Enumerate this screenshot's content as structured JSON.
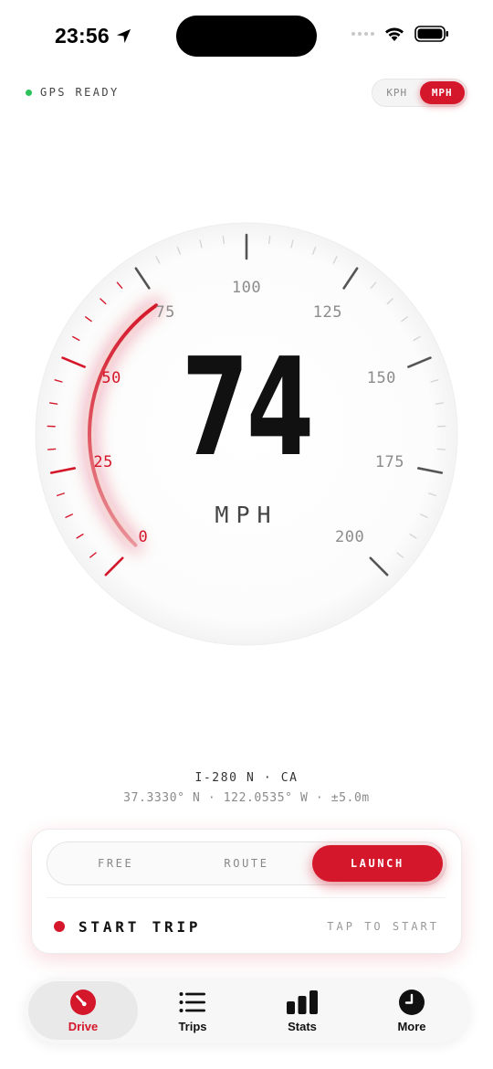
{
  "status_bar": {
    "time": "23:56",
    "icons": [
      "location-arrow-icon",
      "signal-icon",
      "wifi-icon",
      "battery-icon"
    ]
  },
  "header": {
    "gps_status": "GPS READY",
    "gps_color": "#2bc25a",
    "units": [
      {
        "label": "KPH",
        "active": false
      },
      {
        "label": "MPH",
        "active": true
      }
    ]
  },
  "gauge": {
    "speed": "74",
    "unit": "MPH",
    "tick_labels": [
      "0",
      "25",
      "50",
      "75",
      "100",
      "125",
      "150",
      "175",
      "200"
    ],
    "max": 200,
    "accent": "#d4172a"
  },
  "location": {
    "road": "I-280 N · CA",
    "coords": "37.3330° N · 122.0535° W · ±5.0m"
  },
  "trip": {
    "modes": [
      {
        "label": "FREE",
        "active": false
      },
      {
        "label": "ROUTE",
        "active": false
      },
      {
        "label": "LAUNCH",
        "active": true
      }
    ],
    "start_label": "START TRIP",
    "start_hint": "TAP TO START"
  },
  "tabs": [
    {
      "label": "Drive",
      "icon": "speedometer-icon",
      "active": true
    },
    {
      "label": "Trips",
      "icon": "list-icon",
      "active": false
    },
    {
      "label": "Stats",
      "icon": "bar-chart-icon",
      "active": false
    },
    {
      "label": "More",
      "icon": "clock-icon",
      "active": false
    }
  ]
}
